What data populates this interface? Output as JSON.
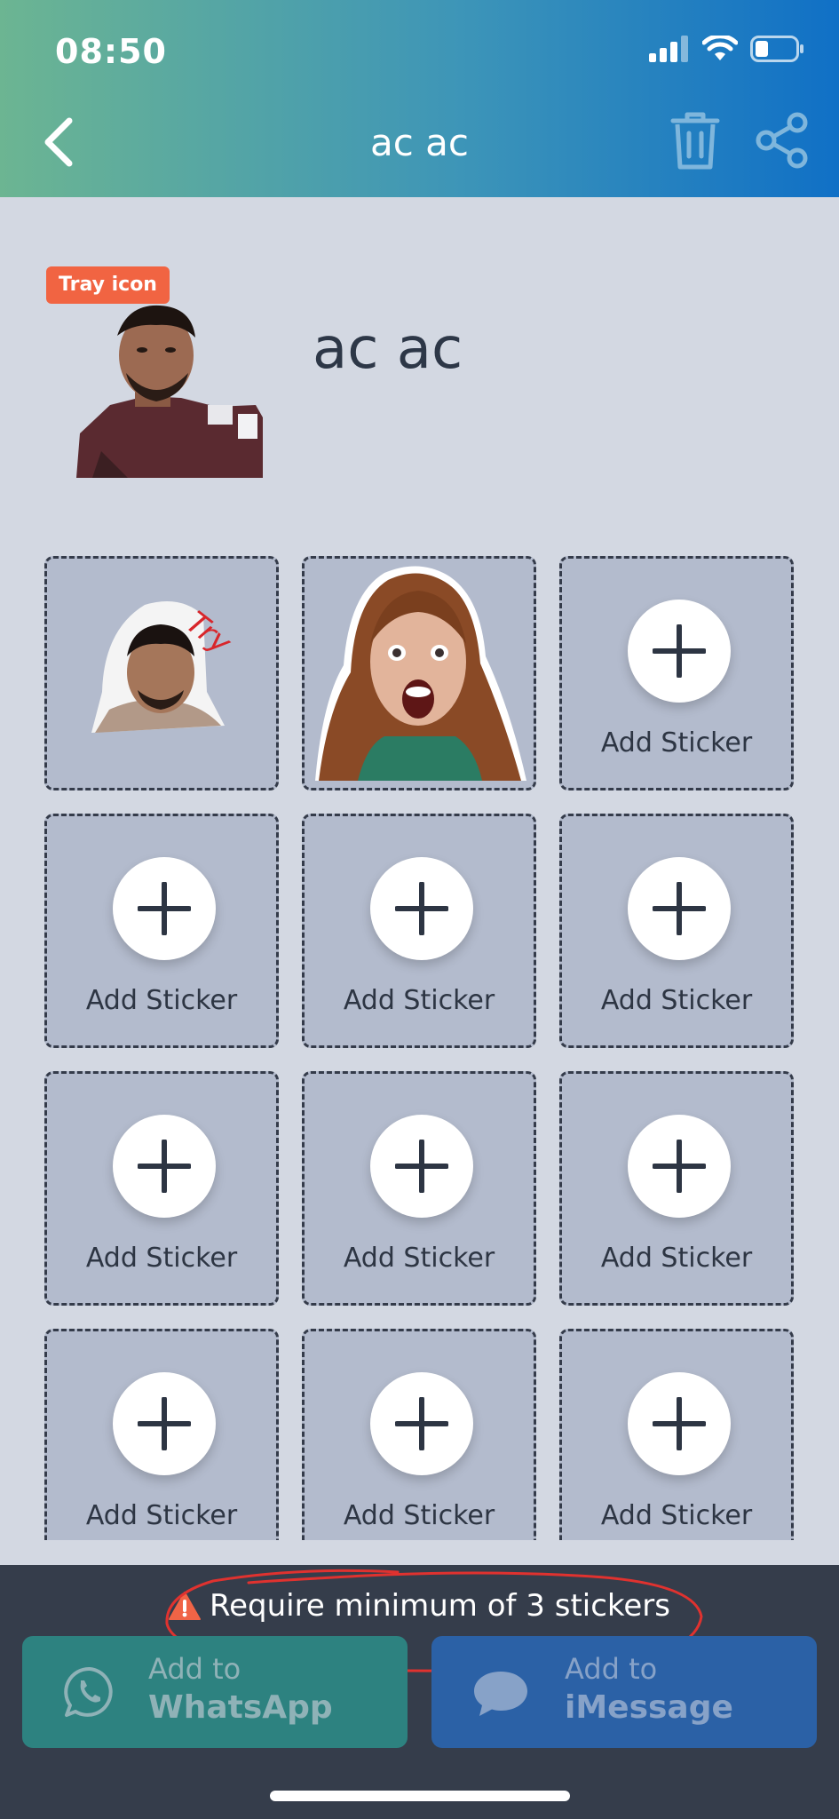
{
  "status_bar": {
    "time": "08:50"
  },
  "nav": {
    "title": "ac ac"
  },
  "tray": {
    "badge": "Tray icon"
  },
  "pack": {
    "title": "ac ac"
  },
  "grid": {
    "add_label": "Add Sticker",
    "sticker_count": 2,
    "slot_count": 12
  },
  "footer": {
    "warning": "Require minimum of 3 stickers",
    "whatsapp": {
      "line1": "Add to",
      "line2": "WhatsApp"
    },
    "imessage": {
      "line1": "Add to",
      "line2": "iMessage"
    }
  },
  "colors": {
    "header_start": "#6cb592",
    "header_end": "#1070c6",
    "badge": "#f16442",
    "whatsapp_button": "#2d8280",
    "imessage_button": "#2b61a6",
    "annotation": "#e0322f"
  }
}
